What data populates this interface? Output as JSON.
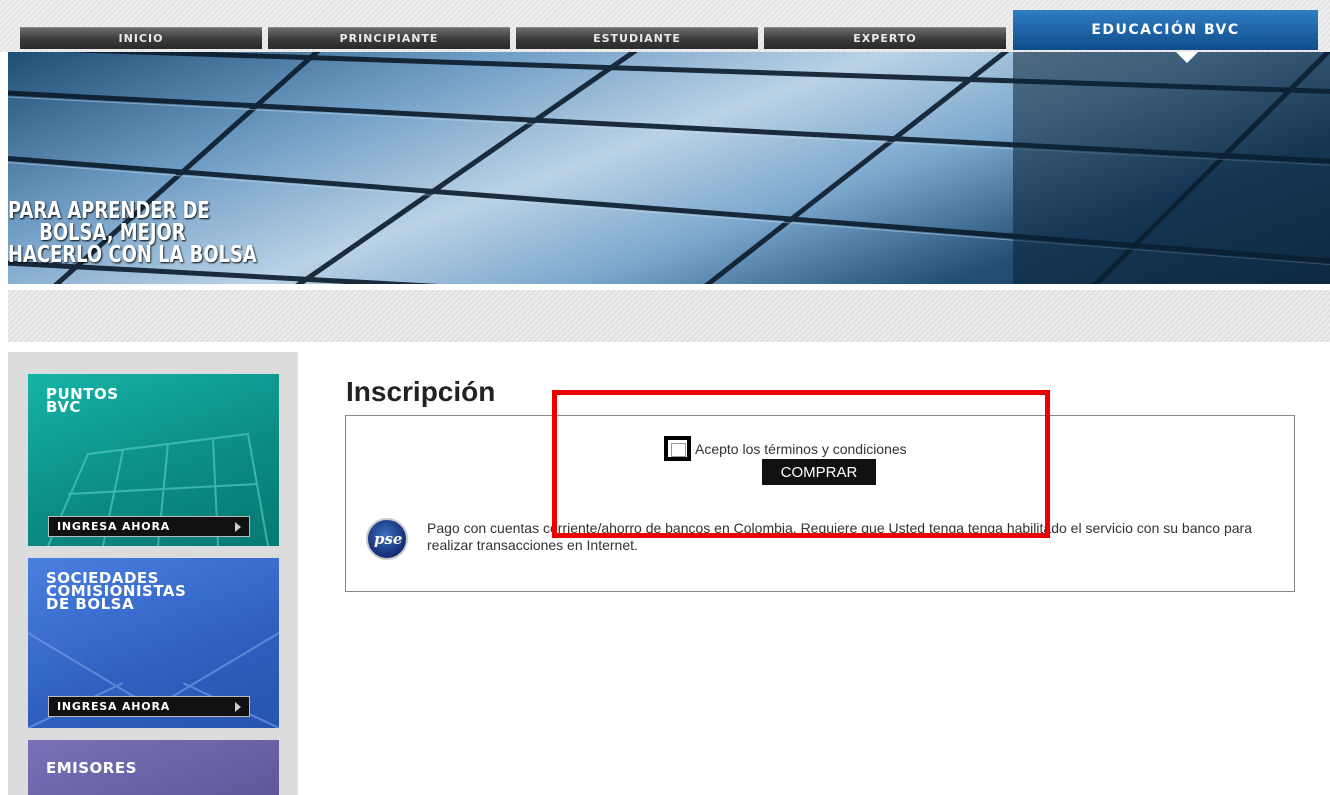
{
  "nav": {
    "tabs": [
      {
        "label": "INICIO"
      },
      {
        "label": "PRINCIPIANTE"
      },
      {
        "label": "ESTUDIANTE"
      },
      {
        "label": "EXPERTO"
      },
      {
        "label": "EDUCACIÓN BVC"
      }
    ],
    "active_tab": "EDUCACIÓN BVC"
  },
  "banner": {
    "slogan_lines": [
      "PARA APRENDER DE",
      "BOLSA, MEJOR",
      "HACERLO CON LA BOLSA"
    ]
  },
  "sidebar": {
    "promos": [
      {
        "title_lines": [
          "PUNTOS",
          "BVC"
        ],
        "button": "INGRESA AHORA",
        "color": "#0f9c93"
      },
      {
        "title_lines": [
          "SOCIEDADES",
          "COMISIONISTAS",
          "DE BOLSA"
        ],
        "button": "INGRESA AHORA",
        "color": "#3566c6"
      },
      {
        "title_lines": [
          "EMISORES"
        ],
        "color": "#6a63a6"
      }
    ]
  },
  "main": {
    "heading": "Inscripción",
    "terms_label": "Acepto los términos y condiciones",
    "buy_button": "COMPRAR",
    "pse_logo_text": "pse",
    "pse_description": "Pago con cuentas corriente/ahorro de bancos en Colombia. Requiere que Usted tenga tenga habilitado el servicio con su banco para realizar transacciones en Internet."
  },
  "colors": {
    "highlight": "#ee0000",
    "active_tab": "#1a5fa3"
  }
}
